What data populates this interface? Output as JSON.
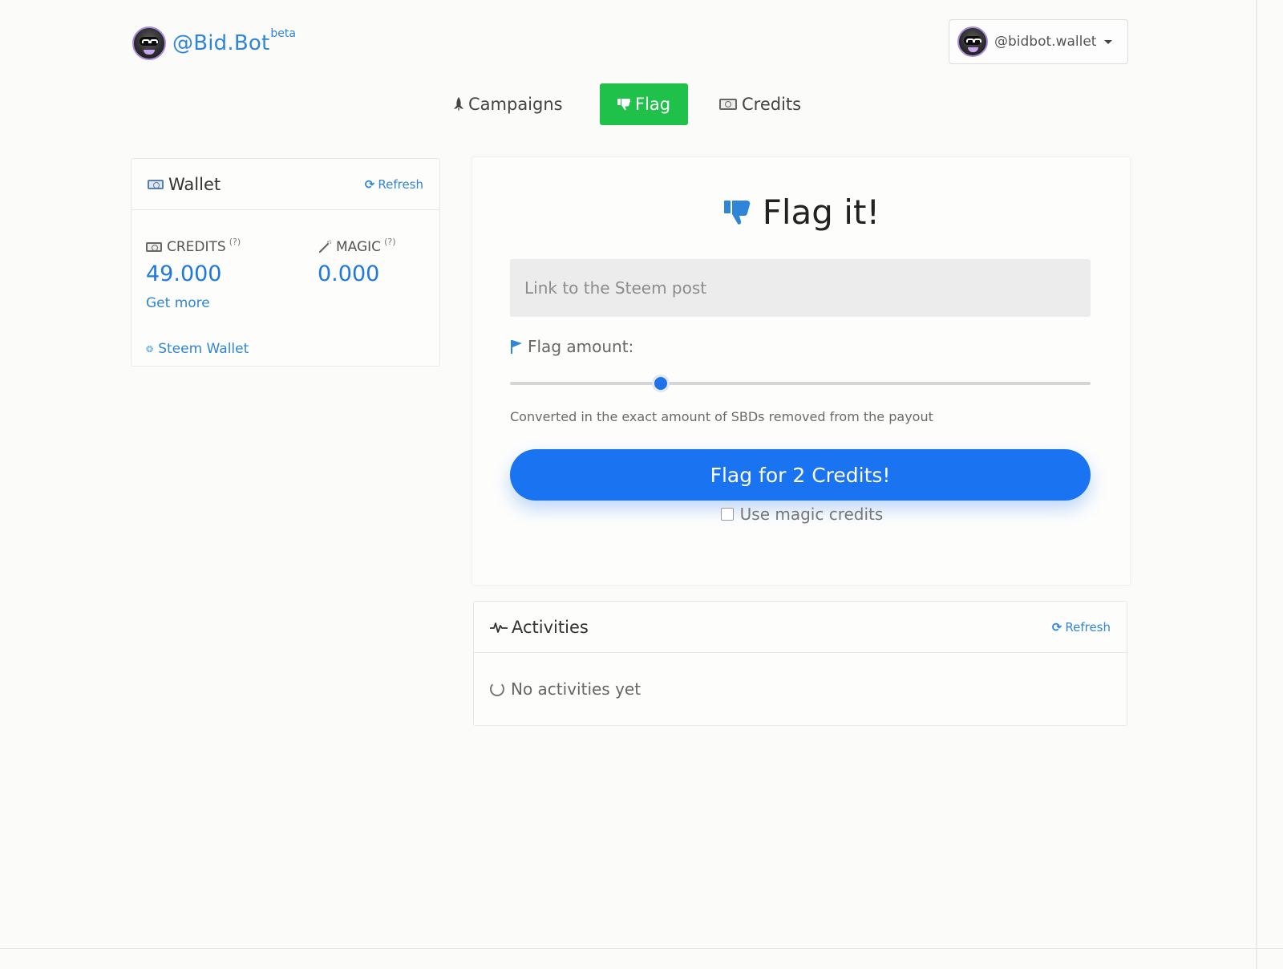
{
  "header": {
    "brand_name": "@Bid.Bot",
    "brand_badge": "beta",
    "account_name": "@bidbot.wallet"
  },
  "nav": {
    "items": [
      {
        "label": "Campaigns",
        "icon": "rocket-icon",
        "active": false
      },
      {
        "label": "Flag",
        "icon": "thumbs-down-icon",
        "active": true
      },
      {
        "label": "Credits",
        "icon": "money-icon",
        "active": false
      }
    ]
  },
  "wallet": {
    "title": "Wallet",
    "refresh_label": "Refresh",
    "credits_label": "CREDITS",
    "credits_help": "(?)",
    "credits_value": "49.000",
    "magic_label": "MAGIC",
    "magic_help": "(?)",
    "magic_value": "0.000",
    "get_more_label": "Get more",
    "steem_wallet_label": "Steem Wallet"
  },
  "flag_form": {
    "title": "Flag it!",
    "link_placeholder": "Link to the Steem post",
    "amount_label": "Flag amount:",
    "slider_fraction": 0.26,
    "hint": "Converted in the exact amount of SBDs removed from the payout",
    "submit_label": "Flag for 2 Credits!",
    "magic_checkbox_label": "Use magic credits"
  },
  "activities": {
    "title": "Activities",
    "refresh_label": "Refresh",
    "empty_message": "No activities yet"
  },
  "colors": {
    "brand_blue": "#2f86d8",
    "active_nav_green": "#1fc14b",
    "primary_button": "#1a73f0"
  }
}
